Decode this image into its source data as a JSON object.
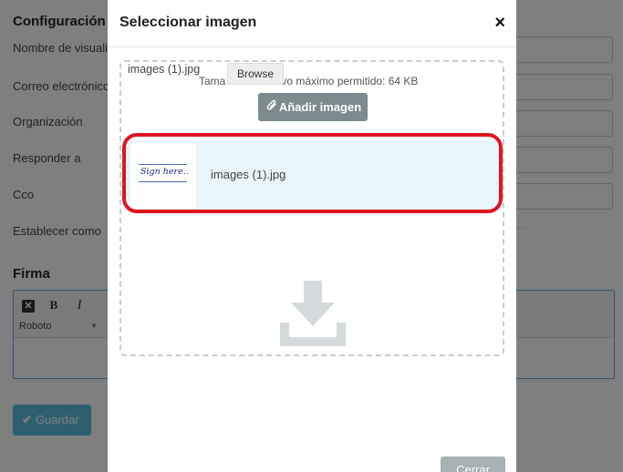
{
  "background": {
    "section_title": "Configuración",
    "fields": [
      {
        "label": "Nombre de visualiz"
      },
      {
        "label": "Correo electrónico"
      },
      {
        "label": "Organización"
      },
      {
        "label": "Responder a"
      },
      {
        "label": "Cco"
      },
      {
        "label": "Establecer como"
      }
    ],
    "firma_title": "Firma",
    "editor": {
      "bold_label": "B",
      "italic_label": "I",
      "clear_label": "✕",
      "font_select_value": "Roboto"
    },
    "save_button": "Guardar"
  },
  "modal": {
    "title": "Seleccionar imagen",
    "close_symbol": "×",
    "file_input": {
      "file_name": "images (1).jpg",
      "browse_label": "Browse"
    },
    "max_size_prefix": "Tama",
    "max_size_suffix": "vo máximo permitido: 64 KB",
    "add_image_button": "Añadir imagen",
    "images": [
      {
        "name": "images (1).jpg",
        "thumbnail_text": "Sign here.."
      }
    ],
    "close_button": "Cerrar"
  },
  "colors": {
    "highlight": "#e01520",
    "primary": "#5bc0de",
    "secondary_button": "#7b8b8e",
    "selected_item_bg": "#e8f5fb"
  },
  "icons": {
    "add": "paperclip-icon",
    "dropzone": "download-icon",
    "save": "check-icon"
  }
}
